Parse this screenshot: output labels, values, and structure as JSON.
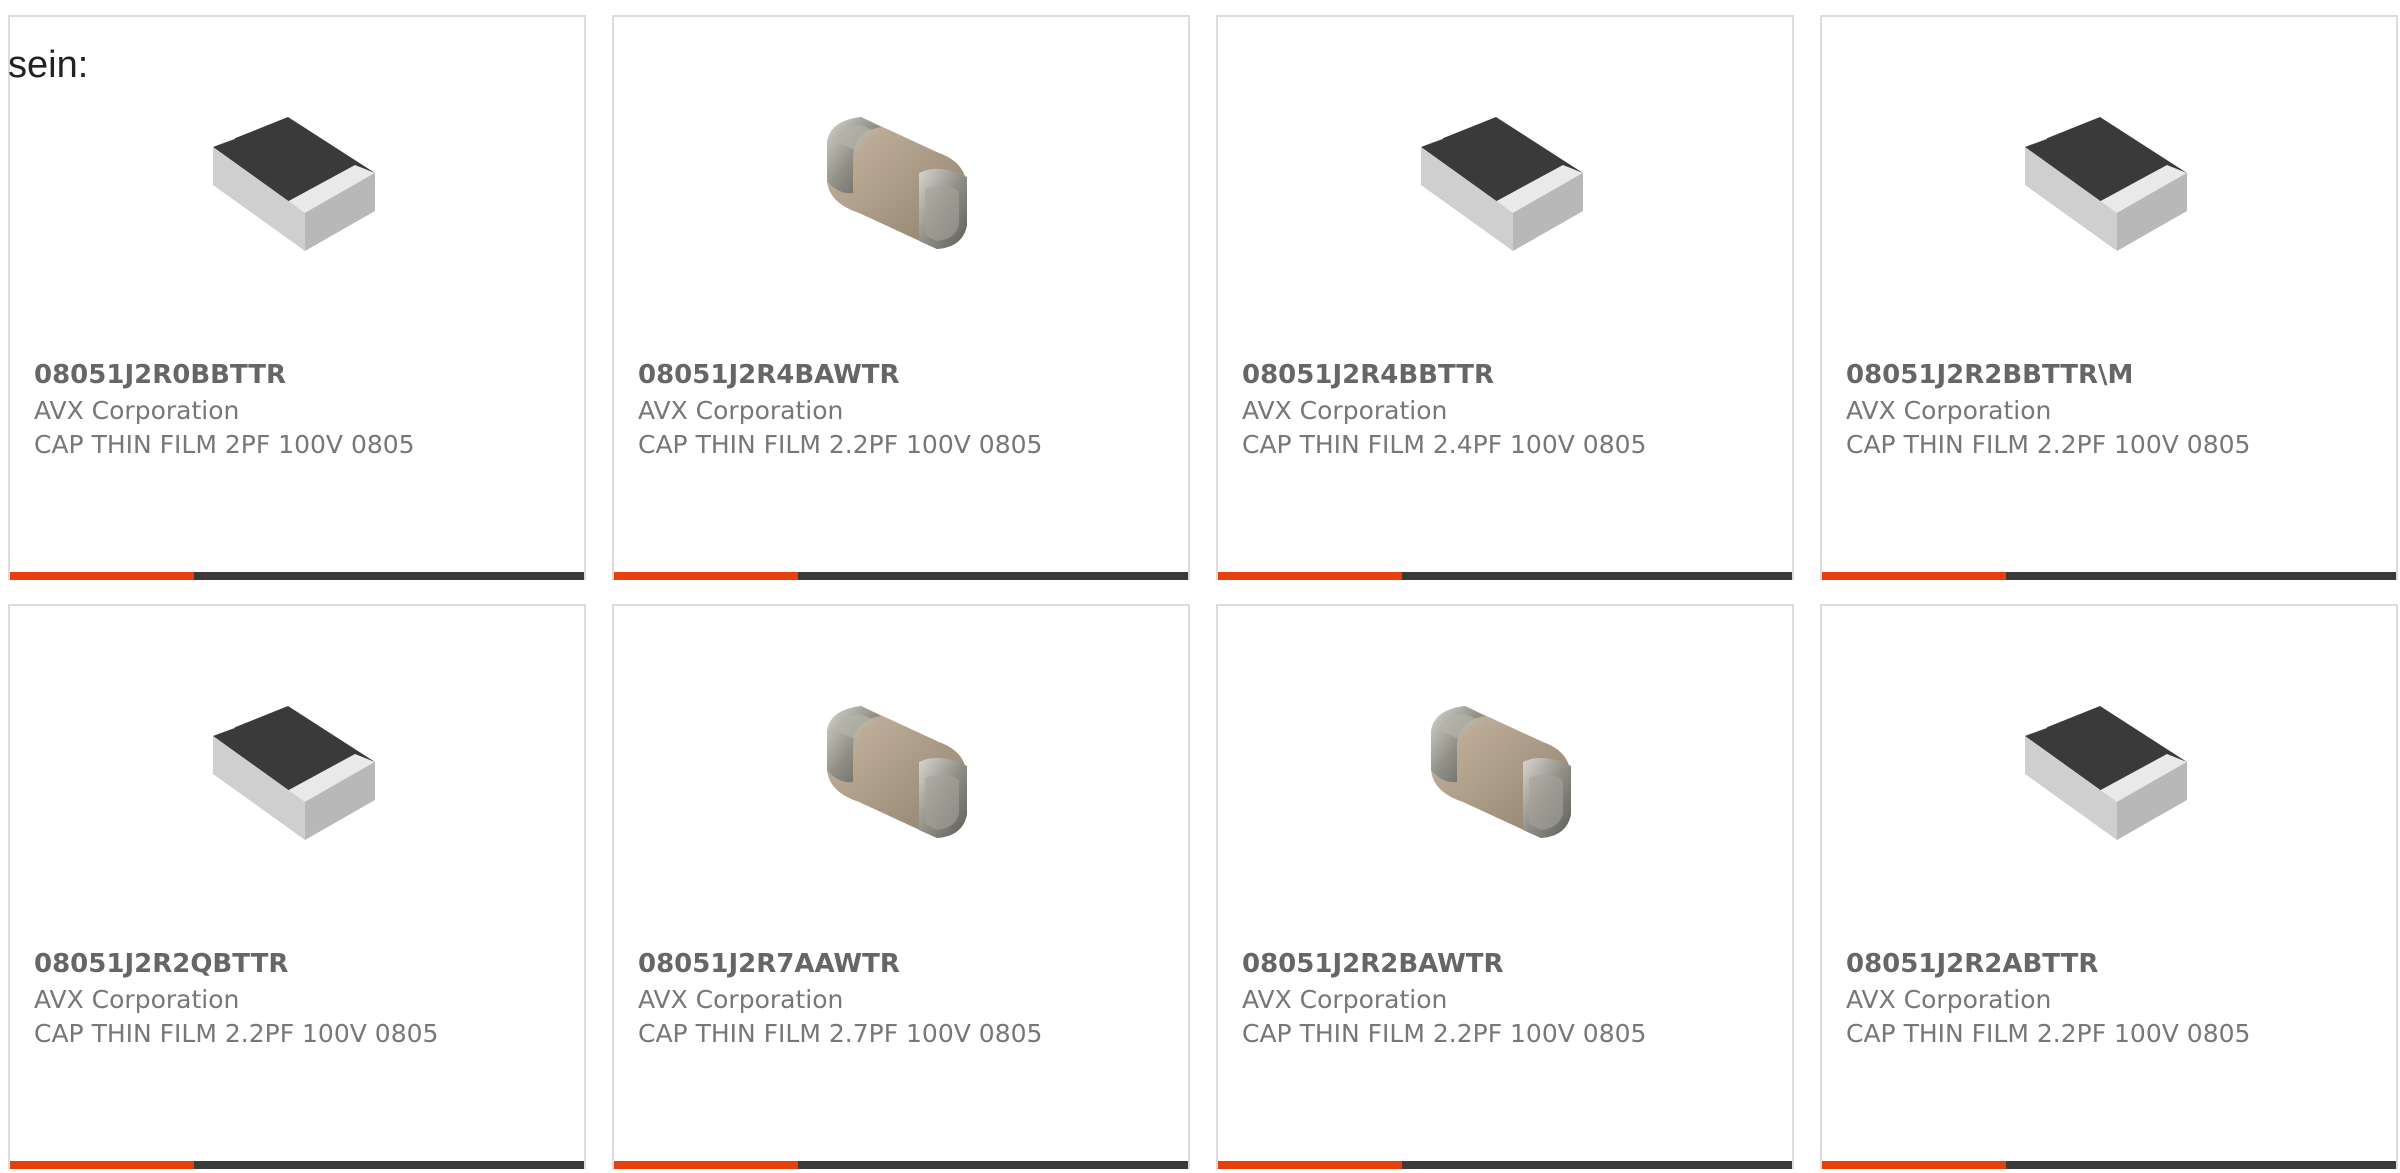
{
  "intro_text": "sein:",
  "colors": {
    "accent": "#e8400c",
    "bar": "#3a3a3a",
    "card_border": "#dcdcdc",
    "text": "#777777",
    "part_text": "#666666"
  },
  "products": [
    {
      "part": "08051J2R0BBTTR",
      "manufacturer": "AVX Corporation",
      "description": "CAP THIN FILM 2PF 100V 0805",
      "image_icon": "smd-chip-icon",
      "accent_fraction": 0.32
    },
    {
      "part": "08051J2R4BAWTR",
      "manufacturer": "AVX Corporation",
      "description": "CAP THIN FILM 2.2PF 100V 0805",
      "image_icon": "ceramic-capacitor-icon",
      "accent_fraction": 0.32
    },
    {
      "part": "08051J2R4BBTTR",
      "manufacturer": "AVX Corporation",
      "description": "CAP THIN FILM 2.4PF 100V 0805",
      "image_icon": "smd-chip-icon",
      "accent_fraction": 0.32
    },
    {
      "part": "08051J2R2BBTTR\\M",
      "manufacturer": "AVX Corporation",
      "description": "CAP THIN FILM 2.2PF 100V 0805",
      "image_icon": "smd-chip-icon",
      "accent_fraction": 0.32
    },
    {
      "part": "08051J2R2QBTTR",
      "manufacturer": "AVX Corporation",
      "description": "CAP THIN FILM 2.2PF 100V 0805",
      "image_icon": "smd-chip-icon",
      "accent_fraction": 0.32
    },
    {
      "part": "08051J2R7AAWTR",
      "manufacturer": "AVX Corporation",
      "description": "CAP THIN FILM 2.7PF 100V 0805",
      "image_icon": "ceramic-capacitor-icon",
      "accent_fraction": 0.32
    },
    {
      "part": "08051J2R2BAWTR",
      "manufacturer": "AVX Corporation",
      "description": "CAP THIN FILM 2.2PF 100V 0805",
      "image_icon": "ceramic-capacitor-icon",
      "accent_fraction": 0.32
    },
    {
      "part": "08051J2R2ABTTR",
      "manufacturer": "AVX Corporation",
      "description": "CAP THIN FILM 2.2PF 100V 0805",
      "image_icon": "smd-chip-icon",
      "accent_fraction": 0.32
    }
  ]
}
